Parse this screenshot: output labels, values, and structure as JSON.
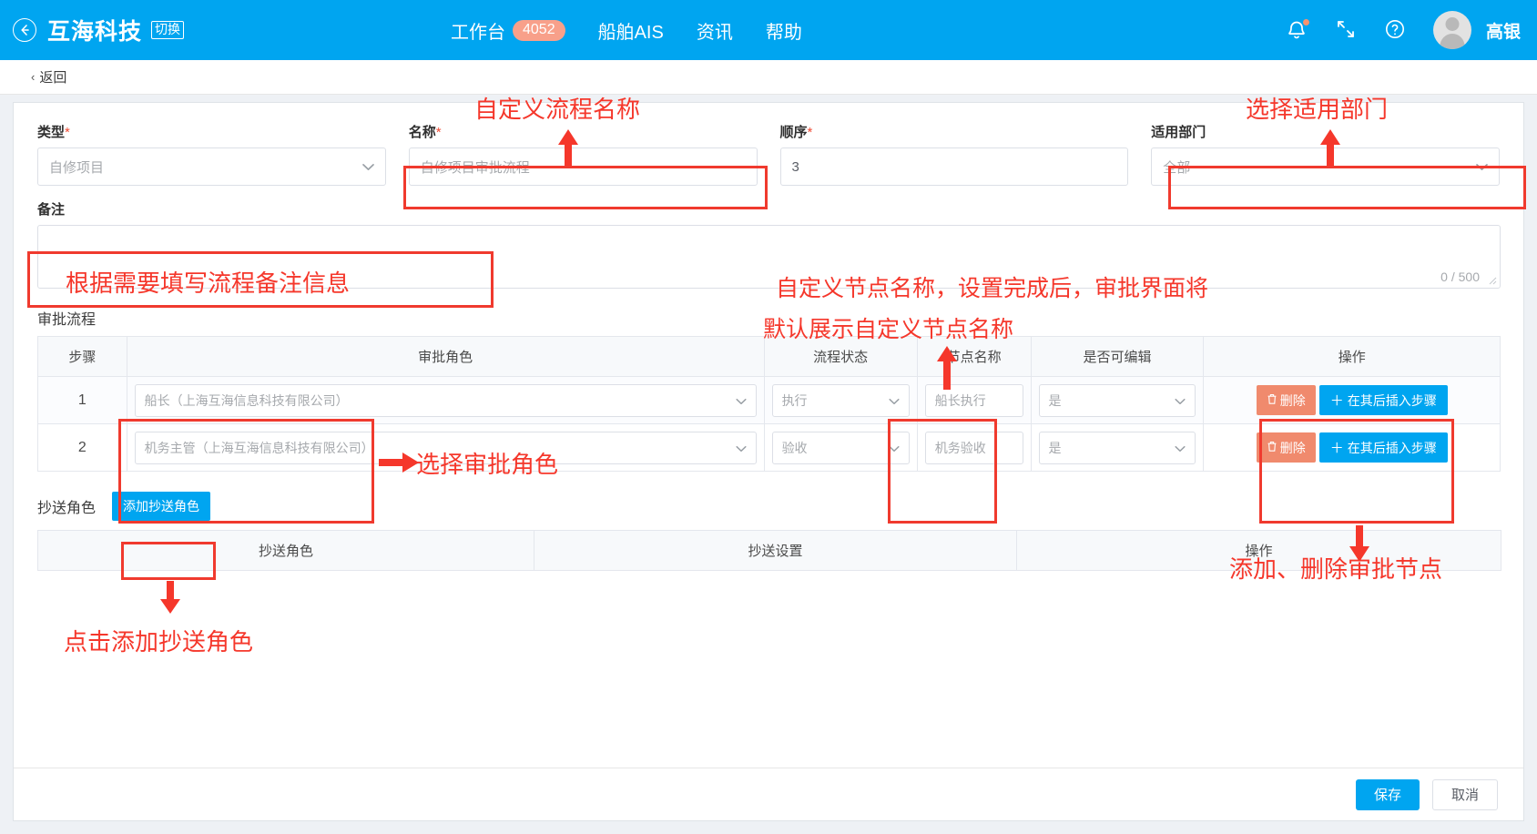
{
  "header": {
    "back_icon": "back-arrow-icon",
    "brand": "互海科技",
    "switch_label": "切换",
    "nav": [
      {
        "label": "工作台",
        "badge": "4052"
      },
      {
        "label": "船舶AIS",
        "badge": ""
      },
      {
        "label": "资讯",
        "badge": ""
      },
      {
        "label": "帮助",
        "badge": ""
      }
    ],
    "icons": [
      "bell-icon",
      "fullscreen-icon",
      "help-icon"
    ],
    "user_name": "高银",
    "brand_color": "#00a5f0",
    "badge_color": "#f8a08a"
  },
  "back_strip": {
    "label": "返回",
    "chevron": "‹"
  },
  "form": {
    "type": {
      "label": "类型",
      "required": "*",
      "value": "自修项目"
    },
    "name": {
      "label": "名称",
      "required": "*",
      "value": "自修项目审批流程"
    },
    "order": {
      "label": "顺序",
      "required": "*",
      "value": "3"
    },
    "dept": {
      "label": "适用部门",
      "required": "",
      "value": "全部"
    },
    "note": {
      "label": "备注",
      "value": "",
      "counter": "0 / 500"
    }
  },
  "flow_section": {
    "title": "审批流程",
    "columns": [
      "步骤",
      "审批角色",
      "流程状态",
      "节点名称",
      "是否可编辑",
      "操作"
    ],
    "rows": [
      {
        "step": "1",
        "role": "船长（上海互海信息科技有限公司）",
        "status": "执行",
        "node": "船长执行",
        "editable": "是",
        "delete_label": "删除",
        "insert_label": "在其后插入步骤"
      },
      {
        "step": "2",
        "role": "机务主管（上海互海信息科技有限公司）",
        "status": "验收",
        "node": "机务验收",
        "editable": "是",
        "delete_label": "删除",
        "insert_label": "在其后插入步骤"
      }
    ]
  },
  "cc_section": {
    "label": "抄送角色",
    "add_button": "添加抄送角色",
    "columns": [
      "抄送角色",
      "抄送设置",
      "操作"
    ]
  },
  "footer": {
    "save": "保存",
    "cancel": "取消"
  },
  "annotations": {
    "a1": "自定义流程名称",
    "a2": "选择适用部门",
    "a3": "根据需要填写流程备注信息",
    "a4_line1": "自定义节点名称，设置完成后，审批界面将",
    "a4_line2": "默认展示自定义节点名称",
    "a5": "选择审批角色",
    "a6": "添加、删除审批节点",
    "a7": "点击添加抄送角色",
    "color": "#f5372b"
  }
}
